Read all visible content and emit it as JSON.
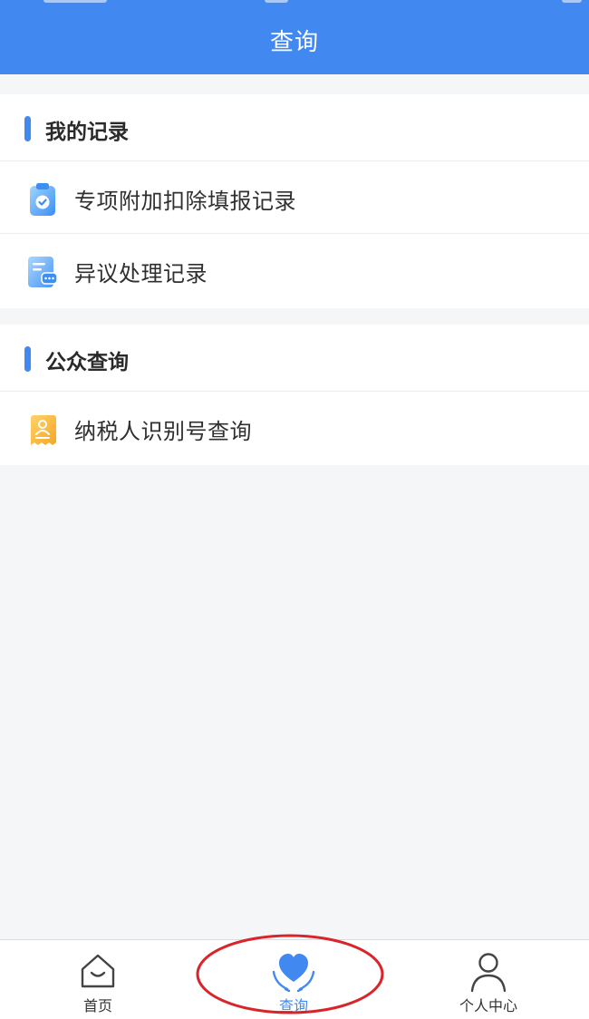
{
  "header": {
    "title": "查询",
    "background": "#4189f0"
  },
  "sections": [
    {
      "title": "我的记录",
      "items": [
        {
          "label": "专项附加扣除填报记录",
          "icon": "clipboard-check-icon"
        },
        {
          "label": "异议处理记录",
          "icon": "document-chat-icon"
        }
      ]
    },
    {
      "title": "公众查询",
      "items": [
        {
          "label": "纳税人识别号查询",
          "icon": "id-card-icon"
        }
      ]
    }
  ],
  "bottom_nav": {
    "items": [
      {
        "label": "首页",
        "icon": "home-icon",
        "active": false
      },
      {
        "label": "查询",
        "icon": "heart-hands-icon",
        "active": true
      },
      {
        "label": "个人中心",
        "icon": "person-icon",
        "active": false
      }
    ]
  },
  "colors": {
    "accent": "#4189f0",
    "highlight": "#d9252a",
    "page_background": "#f5f6f8"
  }
}
